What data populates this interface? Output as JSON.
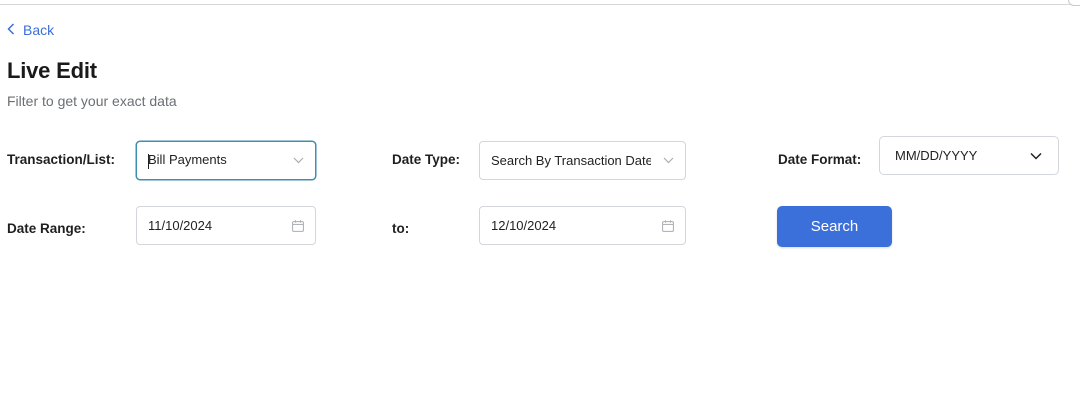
{
  "nav": {
    "back_label": "Back"
  },
  "page": {
    "title": "Live Edit",
    "subtitle": "Filter to get your exact data"
  },
  "filters": {
    "transaction_label": "Transaction/List:",
    "transaction_value": "Bill Payments",
    "date_type_label": "Date Type:",
    "date_type_value": "Search By Transaction Date",
    "date_format_label": "Date Format:",
    "date_format_value": "MM/DD/YYYY",
    "date_range_label": "Date Range:",
    "date_from_value": "11/10/2024",
    "to_label": "to:",
    "date_to_value": "12/10/2024"
  },
  "actions": {
    "search_label": "Search"
  },
  "theme": {
    "accent": "#3b6fd9",
    "focus_border": "#3d8fb0"
  },
  "icons": {
    "back": "chevron-left-icon",
    "select": "chevron-down-icon",
    "date": "calendar-icon"
  }
}
